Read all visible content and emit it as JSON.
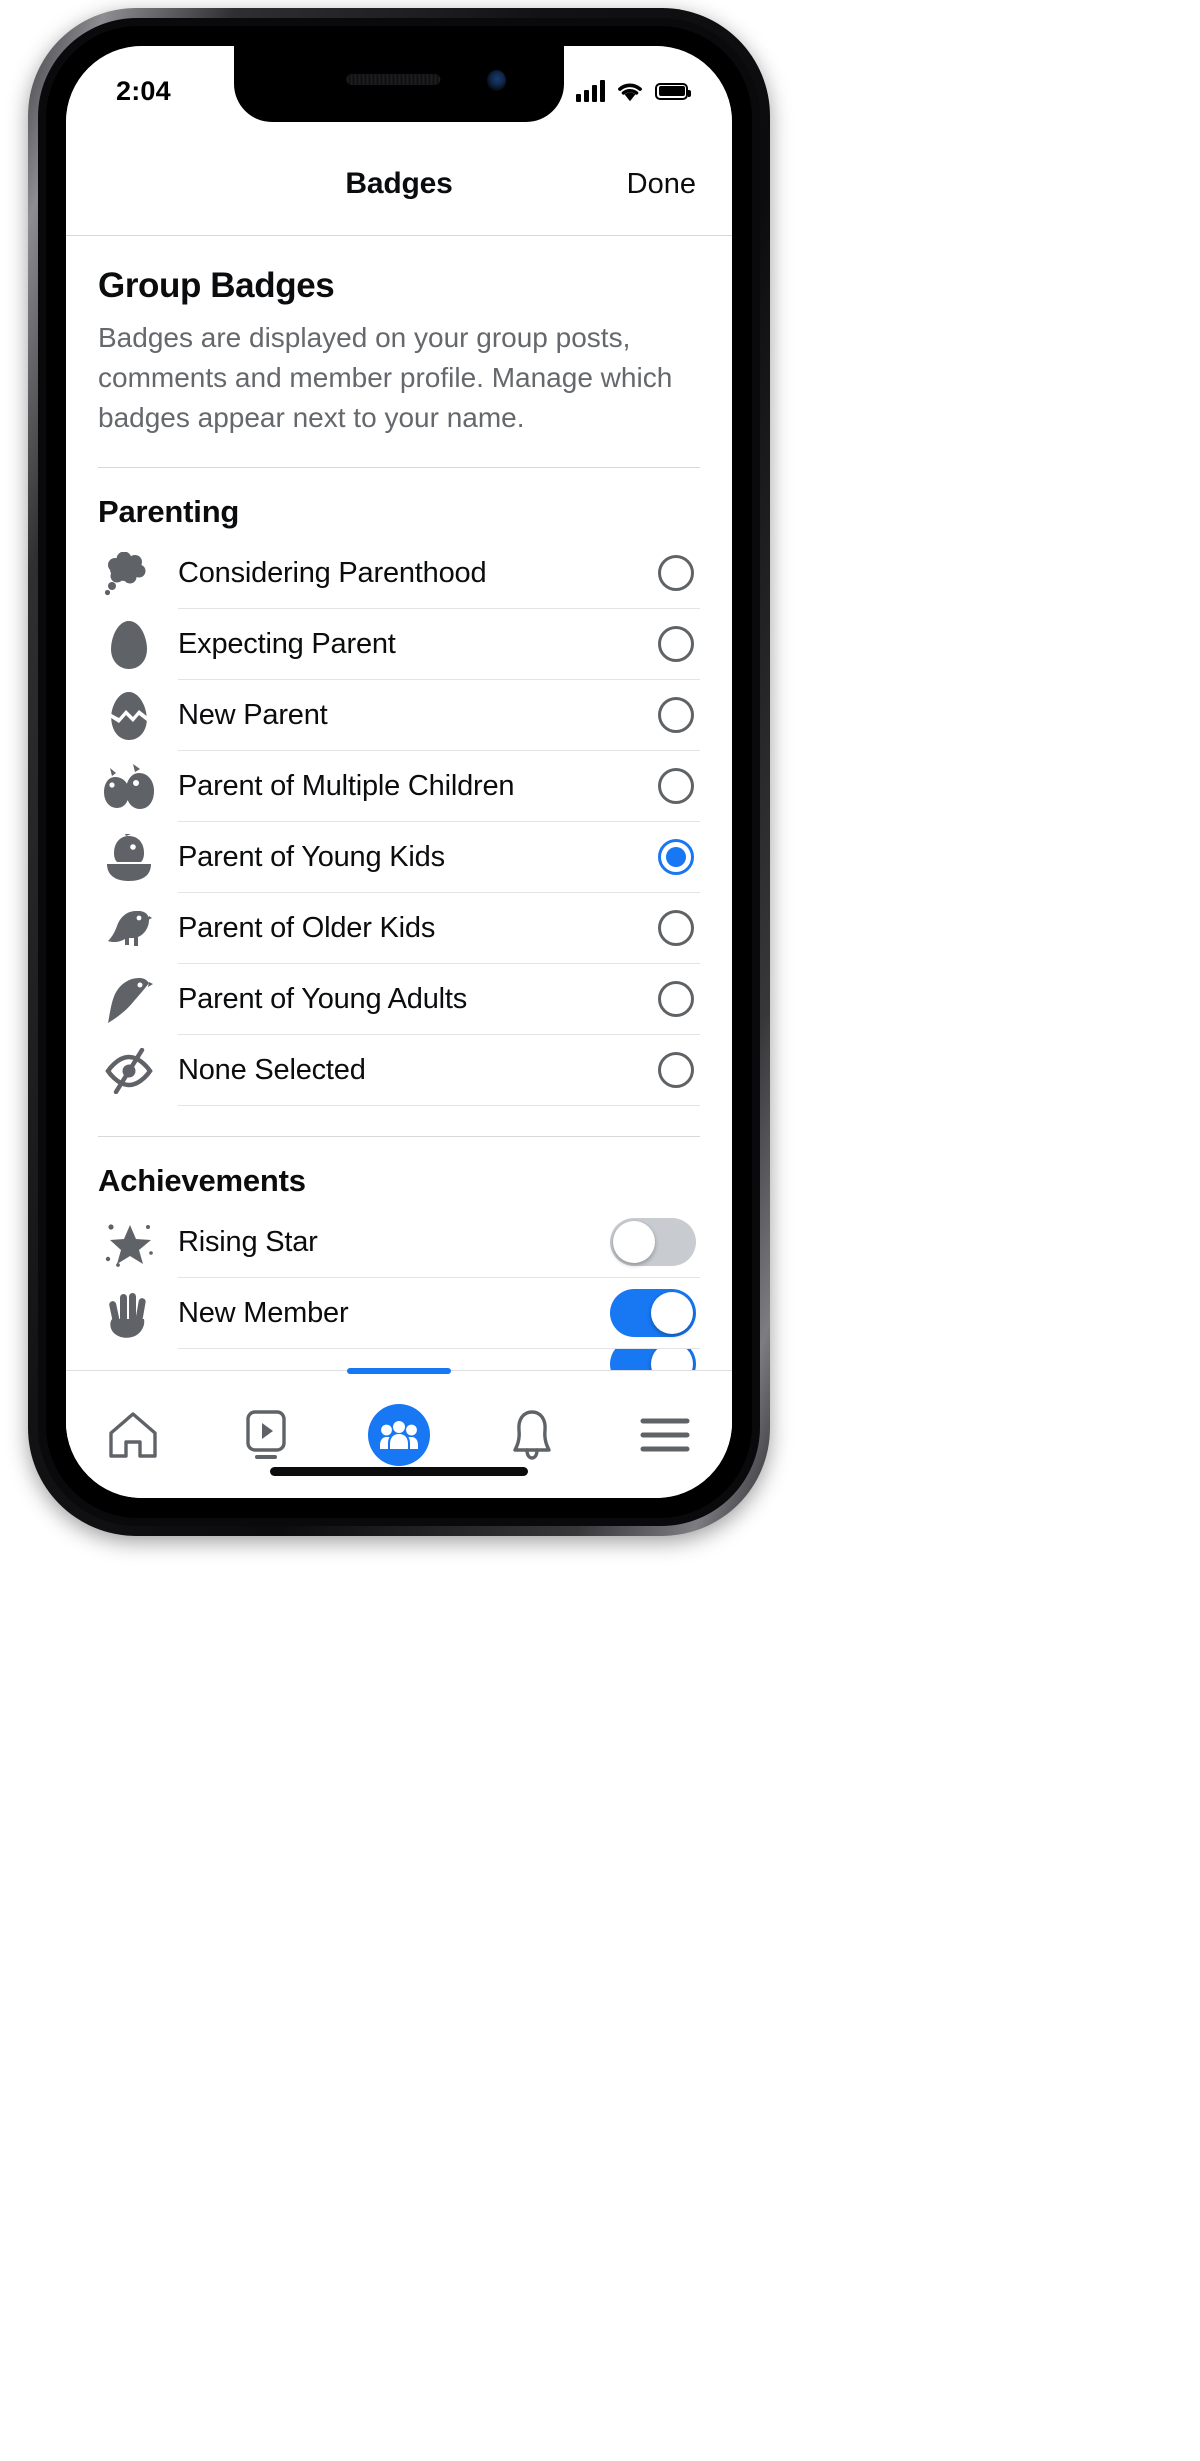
{
  "status_bar": {
    "time": "2:04",
    "signal_icon": "cellular-signal-icon",
    "wifi_icon": "wifi-icon",
    "battery_icon": "battery-full-icon"
  },
  "navbar": {
    "title": "Badges",
    "done_label": "Done"
  },
  "intro": {
    "heading": "Group Badges",
    "description": "Badges are displayed on your group posts, comments and member profile. Manage which badges appear next to your name."
  },
  "sections": [
    {
      "title": "Parenting",
      "control_type": "radio",
      "items": [
        {
          "label": "Considering Parenthood",
          "icon": "thought-cloud-icon",
          "selected": false
        },
        {
          "label": "Expecting Parent",
          "icon": "egg-icon",
          "selected": false
        },
        {
          "label": "New Parent",
          "icon": "cracked-egg-icon",
          "selected": false
        },
        {
          "label": "Parent of Multiple Children",
          "icon": "two-chicks-icon",
          "selected": false
        },
        {
          "label": "Parent of Young Kids",
          "icon": "chick-in-nest-icon",
          "selected": true
        },
        {
          "label": "Parent of Older Kids",
          "icon": "small-bird-icon",
          "selected": false
        },
        {
          "label": "Parent of Young Adults",
          "icon": "flying-bird-icon",
          "selected": false
        },
        {
          "label": "None Selected",
          "icon": "eye-slash-icon",
          "selected": false
        }
      ]
    },
    {
      "title": "Achievements",
      "control_type": "toggle",
      "items": [
        {
          "label": "Rising Star",
          "icon": "star-sparkle-icon",
          "on": false
        },
        {
          "label": "New Member",
          "icon": "waving-hand-icon",
          "on": true
        }
      ]
    }
  ],
  "tabbar": {
    "items": [
      {
        "name": "home",
        "icon": "home-icon",
        "active": false
      },
      {
        "name": "watch",
        "icon": "video-play-icon",
        "active": false
      },
      {
        "name": "groups",
        "icon": "groups-people-icon",
        "active": true
      },
      {
        "name": "notifications",
        "icon": "bell-icon",
        "active": false
      },
      {
        "name": "menu",
        "icon": "hamburger-menu-icon",
        "active": false
      }
    ]
  },
  "colors": {
    "accent": "#1877f2",
    "text_primary": "#0b0c0e",
    "text_secondary": "#65686c",
    "icon_gray": "#5f6368",
    "divider": "#e2e4e7",
    "toggle_off": "#c8ccd1"
  }
}
